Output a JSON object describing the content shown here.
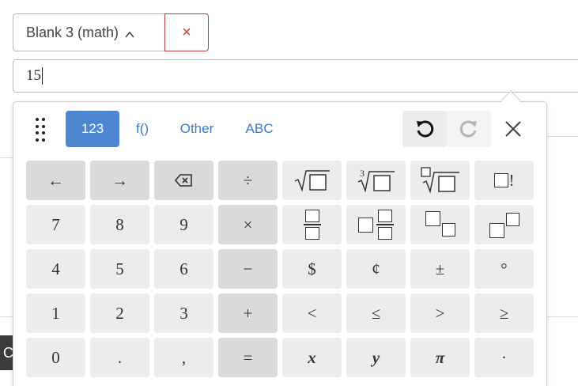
{
  "blank": {
    "label": "Blank 3 (math)",
    "close": "×"
  },
  "answer": {
    "value": "15"
  },
  "keypad": {
    "tabs": [
      {
        "label": "123",
        "active": true
      },
      {
        "label": "f()"
      },
      {
        "label": "Other"
      },
      {
        "label": "ABC"
      }
    ],
    "keys": {
      "left": "←",
      "right": "→",
      "divide": "÷",
      "fact": "!",
      "seven": "7",
      "eight": "8",
      "nine": "9",
      "times": "×",
      "four": "4",
      "five": "5",
      "six": "6",
      "minus": "−",
      "dollar": "$",
      "cent": "¢",
      "plusminus": "±",
      "degree": "°",
      "one": "1",
      "two": "2",
      "three": "3",
      "plus": "+",
      "lt": "<",
      "le": "≤",
      "gt": ">",
      "ge": "≥",
      "zero": "0",
      "dot": ".",
      "comma": ",",
      "equals": "=",
      "x": "x",
      "y": "y",
      "pi": "π",
      "cdot": "·",
      "cube_index": "3"
    }
  },
  "left_button": {
    "label": "C"
  },
  "colors": {
    "accent": "#4e86d1",
    "danger": "#c43a3a"
  }
}
